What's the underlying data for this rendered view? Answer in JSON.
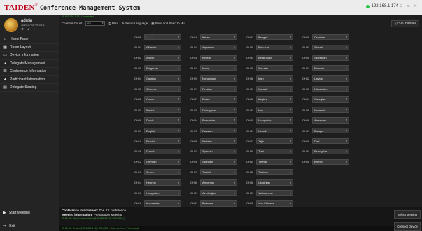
{
  "app": {
    "brand": "TAIDEN",
    "reg": "®",
    "title": "Conference Management System"
  },
  "status": {
    "ip": "192.168.1.174",
    "window_controls": "⊖ ▭ ✕"
  },
  "user": {
    "name": "admin",
    "datetime": "2019-07-08 09:06:41",
    "icons": "⚙ ♠ ✈"
  },
  "nav": [
    {
      "icon": "⌂",
      "label": "Home Page"
    },
    {
      "icon": "▦",
      "label": "Room Layout"
    },
    {
      "icon": "▭",
      "label": "Device Information"
    },
    {
      "icon": "♦",
      "label": "Delegate Management"
    },
    {
      "icon": "☰",
      "label": "Conference Information"
    },
    {
      "icon": "♣",
      "label": "Participant Information"
    },
    {
      "icon": "▤",
      "label": "Delegate Seating"
    }
  ],
  "nav_bottom": [
    {
      "icon": "▶",
      "label": "Start Meeting"
    },
    {
      "icon": "⇥",
      "label": "Exit"
    }
  ],
  "subbar": {
    "text": "SI 192.168.1.174 Connected"
  },
  "toolbar": {
    "channel_count_label": "Channel Count",
    "channel_count_value": "63",
    "print_label": "Print",
    "setup_language_label": "Setup Language",
    "save_label": "Save and Send to MU",
    "si_channel_label": "SI Channel"
  },
  "channels": [
    [
      {
        "ch": "CH00",
        "lang": "Floor"
      },
      {
        "ch": "CH16",
        "lang": "Italian"
      },
      {
        "ch": "CH32",
        "lang": "Bengali"
      },
      {
        "ch": "CH48",
        "lang": "Croatian"
      }
    ],
    [
      {
        "ch": "CH01",
        "lang": "Albanian"
      },
      {
        "ch": "CH17",
        "lang": "Japanese"
      },
      {
        "ch": "CH33",
        "lang": "Burmese"
      },
      {
        "ch": "CH49",
        "lang": "Slovak"
      }
    ],
    [
      {
        "ch": "CH02",
        "lang": "Arabic"
      },
      {
        "ch": "CH18",
        "lang": "Korean"
      },
      {
        "ch": "CH34",
        "lang": "Belarusian"
      },
      {
        "ch": "CH50",
        "lang": "Slovenian"
      }
    ],
    [
      {
        "ch": "CH03",
        "lang": "Bulgarian"
      },
      {
        "ch": "CH19",
        "lang": "Malay"
      },
      {
        "ch": "CH35",
        "lang": "Cornish"
      },
      {
        "ch": "CH51",
        "lang": "Estonian"
      }
    ],
    [
      {
        "ch": "CH04",
        "lang": "Catalan"
      },
      {
        "ch": "CH20",
        "lang": "Norwegian"
      },
      {
        "ch": "CH36",
        "lang": "Irish"
      },
      {
        "ch": "CH52",
        "lang": "Latvian"
      }
    ],
    [
      {
        "ch": "CH05",
        "lang": "Chinese"
      },
      {
        "ch": "CH21",
        "lang": "Persian"
      },
      {
        "ch": "CH37",
        "lang": "Kazakh"
      },
      {
        "ch": "CH53",
        "lang": "Lithuanian"
      }
    ],
    [
      {
        "ch": "CH06",
        "lang": "Czech"
      },
      {
        "ch": "CH22",
        "lang": "Polish"
      },
      {
        "ch": "CH38",
        "lang": "Kirghiz"
      },
      {
        "ch": "CH54",
        "lang": "Georgian"
      }
    ],
    [
      {
        "ch": "CH07",
        "lang": "Danish"
      },
      {
        "ch": "CH23",
        "lang": "Portuguese"
      },
      {
        "ch": "CH39",
        "lang": "Lao"
      },
      {
        "ch": "CH55",
        "lang": "Icelandic"
      }
    ],
    [
      {
        "ch": "CH08",
        "lang": "Dutch"
      },
      {
        "ch": "CH24",
        "lang": "Romanian"
      },
      {
        "ch": "CH40",
        "lang": "Mongolian"
      },
      {
        "ch": "CH56",
        "lang": "Armenian"
      }
    ],
    [
      {
        "ch": "CH09",
        "lang": "English"
      },
      {
        "ch": "CH25",
        "lang": "Russian"
      },
      {
        "ch": "CH41",
        "lang": "Nepali"
      },
      {
        "ch": "CH57",
        "lang": "Basque"
      }
    ],
    [
      {
        "ch": "CH10",
        "lang": "Finnish"
      },
      {
        "ch": "CH26",
        "lang": "Serbian"
      },
      {
        "ch": "CH42",
        "lang": "Tajik"
      },
      {
        "ch": "CH58",
        "lang": "Dari"
      }
    ],
    [
      {
        "ch": "CH11",
        "lang": "French"
      },
      {
        "ch": "CH27",
        "lang": "Spanish"
      },
      {
        "ch": "CH43",
        "lang": "Thai"
      },
      {
        "ch": "CH59",
        "lang": "Dzongkha"
      }
    ],
    [
      {
        "ch": "CH12",
        "lang": "German"
      },
      {
        "ch": "CH28",
        "lang": "Swedish"
      },
      {
        "ch": "CH44",
        "lang": "Tibetan"
      },
      {
        "ch": "CH60",
        "lang": "Brunei"
      }
    ],
    [
      {
        "ch": "CH13",
        "lang": "Greek"
      },
      {
        "ch": "CH29",
        "lang": "Turkish"
      },
      {
        "ch": "CH45",
        "lang": "Turkmen"
      },
      null
    ],
    [
      {
        "ch": "CH14",
        "lang": "Hebrew"
      },
      {
        "ch": "CH30",
        "lang": "Armenian"
      },
      {
        "ch": "CH46",
        "lang": "Ukrainian"
      },
      null
    ],
    [
      {
        "ch": "CH15",
        "lang": "Hungarian"
      },
      {
        "ch": "CH31",
        "lang": "Azerbaijani"
      },
      {
        "ch": "CH47",
        "lang": "Vietnamese"
      },
      null
    ],
    [
      {
        "ch": "CH16",
        "lang": "Indonesian"
      },
      {
        "ch": "CH32",
        "lang": "Balinese"
      },
      {
        "ch": "CH48",
        "lang": "Yue Chinese"
      },
      null
    ]
  ],
  "footer": {
    "conference_label": "Conference information:",
    "conference_value": "The XX conference",
    "meeting_label": "Meeting information:",
    "meeting_value": "Preparatory Meeting",
    "log1": "09:06:46 : Start connect device(192.168.1.174) HCS-8300 ()",
    "log2": "09:06:45 : Device(192.168.1.174) HCS-8300 / Data received, Please wait.",
    "select_meeting_label": "Select Meeting",
    "connect_device_label": "Connect Device"
  },
  "colors": {
    "accent_green": "#3fae3f",
    "status_dot": "#2cc44a",
    "brand_red": "#c0001a"
  }
}
